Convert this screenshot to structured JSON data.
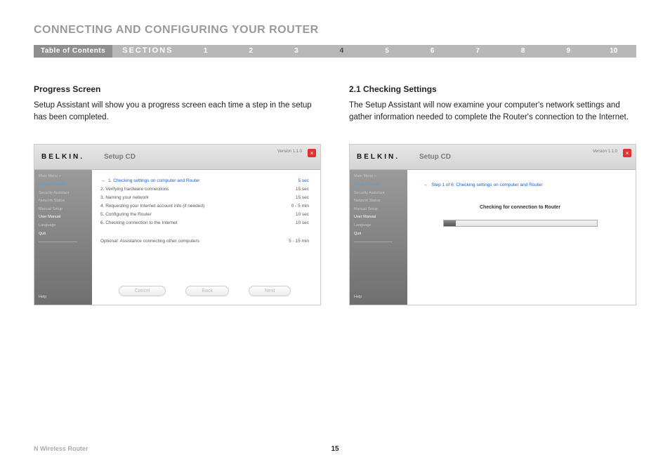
{
  "page_title": "CONNECTING AND CONFIGURING YOUR ROUTER",
  "nav": {
    "toc": "Table of Contents",
    "sections": "SECTIONS",
    "numbers": [
      "1",
      "2",
      "3",
      "4",
      "5",
      "6",
      "7",
      "8",
      "9",
      "10"
    ],
    "active": "4"
  },
  "left": {
    "heading": "Progress Screen",
    "body": "Setup Assistant will show you a progress screen each time a step in the setup has been completed."
  },
  "right": {
    "heading": "2.1 Checking Settings",
    "body": "The Setup Assistant will now examine your computer's network settings and gather information needed to complete the Router's connection to the Internet."
  },
  "card": {
    "brand": "BELKIN.",
    "title": "Setup CD",
    "version": "Version 1.1.0",
    "close": "×",
    "sidebar": {
      "main_menu": "Main Menu  »",
      "setup_assistant": "Setup Assistant",
      "security_assistant": "Security Assistant",
      "network_status": "Network Status",
      "manual_setup": "Manual Setup",
      "user_manual": "User Manual",
      "language": "Language",
      "quit": "Quit",
      "help": "Help"
    },
    "steps": [
      {
        "label": "1. Checking settings on computer and Router",
        "time": "5 sec",
        "current": true
      },
      {
        "label": "2. Verifying hardware connections",
        "time": "15 sec"
      },
      {
        "label": "3. Naming your network",
        "time": "15 sec"
      },
      {
        "label": "4. Requesting your Internet account info (if needed)",
        "time": "0 - 5 min"
      },
      {
        "label": "5. Configuring the Router",
        "time": "10 sec"
      },
      {
        "label": "6. Checking connection to the Internet",
        "time": "10 sec"
      }
    ],
    "optional": {
      "label": "Optional: Assistance connecting other computers",
      "time": "5 - 15 min"
    },
    "buttons": {
      "cancel": "Cancel",
      "back": "Back",
      "next": "Next"
    }
  },
  "card2": {
    "step_title": "Step 1 of 6: Checking settings on computer and Router",
    "check_msg": "Checking for connection to Router"
  },
  "footer": {
    "product": "N Wireless Router",
    "page": "15"
  }
}
